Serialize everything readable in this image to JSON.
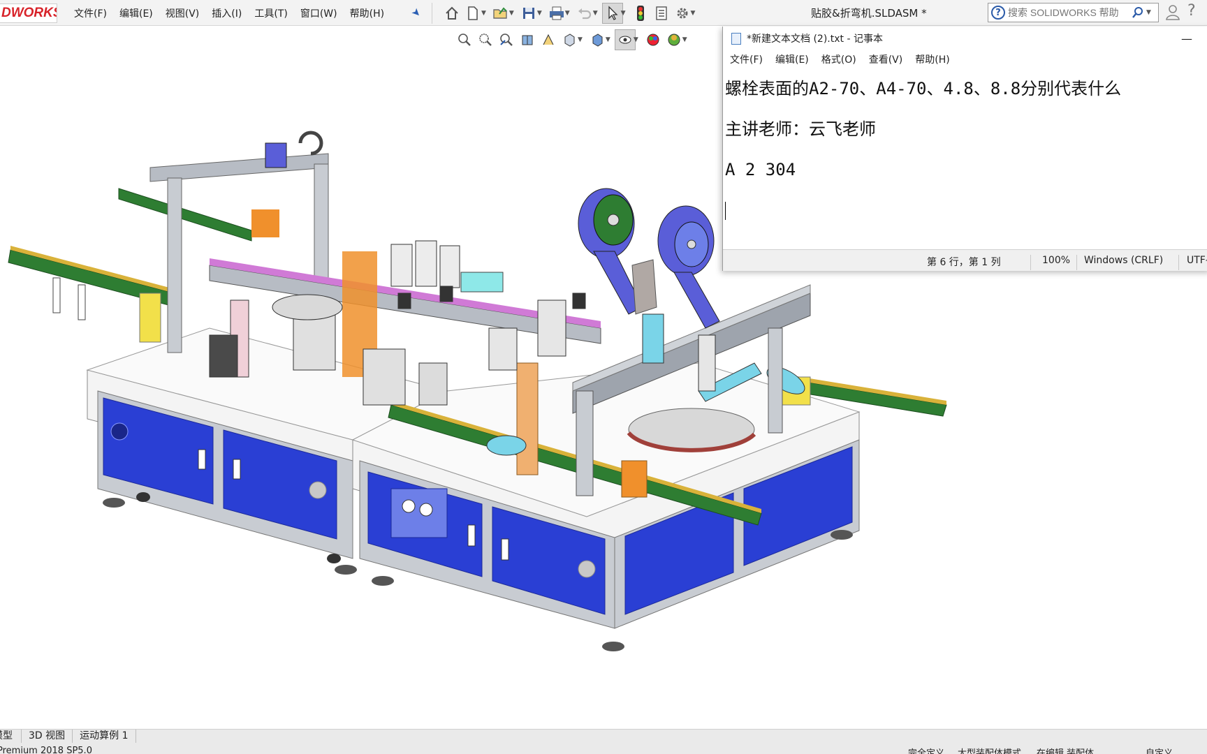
{
  "app": {
    "logo_text": "DWORKS",
    "menu": [
      "文件(F)",
      "编辑(E)",
      "视图(V)",
      "插入(I)",
      "工具(T)",
      "窗口(W)",
      "帮助(H)"
    ],
    "document_title": "贴胶&折弯机.SLDASM *",
    "search_placeholder": "搜索 SOLIDWORKS 帮助",
    "toolbar_icons": [
      "home-icon",
      "new-document-icon",
      "open-folder-icon",
      "save-icon",
      "print-icon",
      "undo-icon",
      "select-pointer-icon",
      "traffic-light-icon",
      "file-properties-icon",
      "options-gear-icon"
    ],
    "view_toolbar_icons": [
      "zoom-to-fit-icon",
      "zoom-area-icon",
      "previous-view-icon",
      "section-view-icon",
      "dynamic-annotation-icon",
      "view-orientation-icon",
      "display-style-icon",
      "hide-show-items-icon",
      "edit-appearance-icon",
      "apply-scene-icon"
    ],
    "accent_color": "#d8232a"
  },
  "notepad": {
    "title": "*新建文本文档 (2).txt - 记事本",
    "menu": [
      "文件(F)",
      "编辑(E)",
      "格式(O)",
      "查看(V)",
      "帮助(H)"
    ],
    "lines": [
      "螺栓表面的A2-70、A4-70、4.8、8.8分别代表什么",
      "主讲老师：云飞老师",
      "A 2 304"
    ],
    "status": {
      "position": "第 6 行，第 1 列",
      "zoom": "100%",
      "line_ending": "Windows (CRLF)",
      "encoding": "UTF-"
    }
  },
  "bottom_tabs": [
    "模型",
    "3D 视图",
    "运动算例 1"
  ],
  "status_bar": {
    "version": "Premium 2018 SP5.0",
    "definition": "完全定义",
    "mode": "大型装配体模式",
    "editing": "在编辑 装配体",
    "custom": "自定义"
  },
  "model_colors": {
    "panel_blue": "#2a3fd4",
    "frame_gray": "#c8ccd2",
    "belt_green": "#2e7d32",
    "orange_part": "#f0902c"
  }
}
